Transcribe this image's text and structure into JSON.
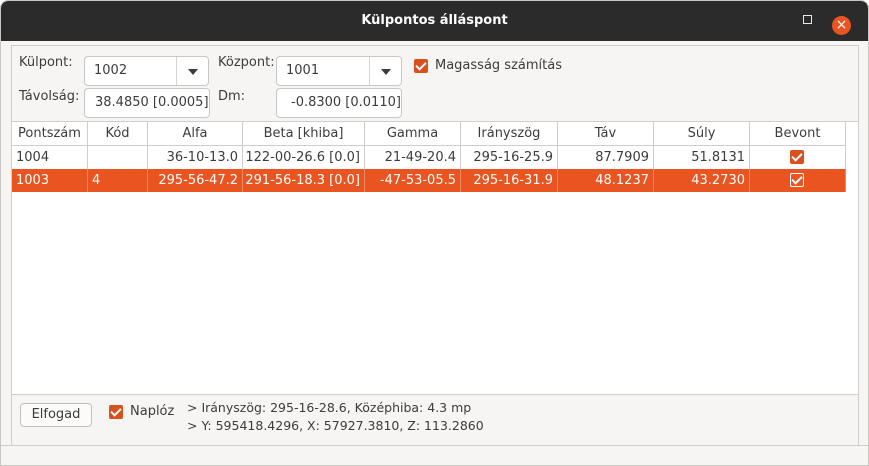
{
  "window": {
    "title": "Külpontos álláspont"
  },
  "form": {
    "kulpont_label": "Külpont:",
    "kulpont_value": "1002",
    "kozpont_label": "Központ:",
    "kozpont_value": "1001",
    "magassag_label": "Magasság számítás",
    "magassag_checked": true,
    "tavolsag_label": "Távolság:",
    "tavolsag_value": "38.4850 [0.0005]",
    "dm_label": "Dm:",
    "dm_value": "-0.8300 [0.0110]"
  },
  "table": {
    "columns": [
      "Pontszám",
      "Kód",
      "Alfa",
      "Beta [khiba]",
      "Gamma",
      "Irányszög",
      "Táv",
      "Súly",
      "Bevont"
    ],
    "rows": [
      {
        "pontszam": "1004",
        "kod": "",
        "alfa": "36-10-13.0",
        "beta": "122-00-26.6 [0.0]",
        "gamma": "21-49-20.4",
        "iranyszog": "295-16-25.9",
        "tav": "87.7909",
        "suly": "51.8131",
        "bevont": true,
        "selected": false
      },
      {
        "pontszam": "1003",
        "kod": "4",
        "alfa": "295-56-47.2",
        "beta": "291-56-18.3 [0.0]",
        "gamma": "-47-53-05.5",
        "iranyszog": "295-16-31.9",
        "tav": "48.1237",
        "suly": "43.2730",
        "bevont": true,
        "selected": true
      }
    ]
  },
  "footer": {
    "accept_label": "Elfogad",
    "log_label": "Naplóz",
    "log_checked": true,
    "result_line1": "> Irányszög: 295-16-28.6, Középhiba: 4.3 mp",
    "result_line2": "> Y: 595418.4296, X: 57927.3810, Z: 113.2860"
  },
  "colors": {
    "accent": "#e95420",
    "titlebar": "#2b2b2b"
  }
}
